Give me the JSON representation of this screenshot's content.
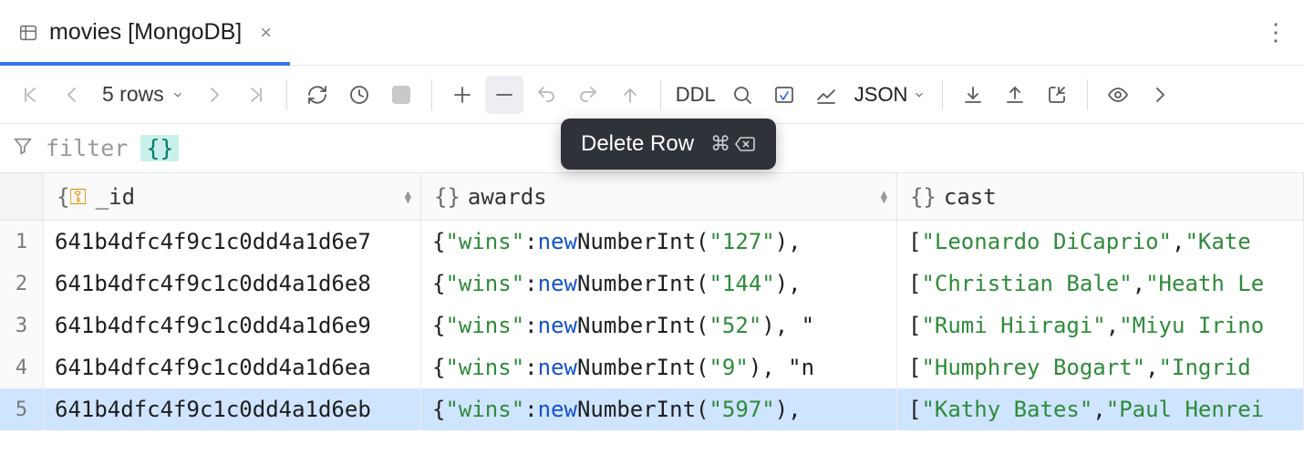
{
  "tab": {
    "title": "movies [MongoDB]"
  },
  "toolbar": {
    "rowcount": "5 rows",
    "ddl": "DDL",
    "format": "JSON"
  },
  "tooltip": {
    "label": "Delete Row",
    "shortcut_symbol": "⌘",
    "shortcut_key": "⌫"
  },
  "filter": {
    "placeholder": "filter",
    "braces": "{}"
  },
  "columns": {
    "id": "_id",
    "awards": "awards",
    "cast": "cast"
  },
  "rows": [
    {
      "num": "1",
      "id": "641b4dfc4f9c1c0dd4a1d6e7",
      "awards": {
        "wins_key": "\"wins\"",
        "kw": "new",
        "fn": "NumberInt(",
        "val": "\"127\"",
        "tail": "),"
      },
      "cast": {
        "open": "[",
        "a": "\"Leonardo DiCaprio\"",
        "sep": ", ",
        "b": "\"Kate"
      }
    },
    {
      "num": "2",
      "id": "641b4dfc4f9c1c0dd4a1d6e8",
      "awards": {
        "wins_key": "\"wins\"",
        "kw": "new",
        "fn": "NumberInt(",
        "val": "\"144\"",
        "tail": "),"
      },
      "cast": {
        "open": "[",
        "a": "\"Christian Bale\"",
        "sep": ", ",
        "b": "\"Heath Le"
      }
    },
    {
      "num": "3",
      "id": "641b4dfc4f9c1c0dd4a1d6e9",
      "awards": {
        "wins_key": "\"wins\"",
        "kw": "new",
        "fn": "NumberInt(",
        "val": "\"52\"",
        "tail": "), \""
      },
      "cast": {
        "open": "[",
        "a": "\"Rumi Hiiragi\"",
        "sep": ", ",
        "b": "\"Miyu Irino"
      }
    },
    {
      "num": "4",
      "id": "641b4dfc4f9c1c0dd4a1d6ea",
      "awards": {
        "wins_key": "\"wins\"",
        "kw": "new",
        "fn": "NumberInt(",
        "val": "\"9\"",
        "tail": "), \"n"
      },
      "cast": {
        "open": "[",
        "a": "\"Humphrey Bogart\"",
        "sep": ", ",
        "b": "\"Ingrid"
      }
    },
    {
      "num": "5",
      "id": "641b4dfc4f9c1c0dd4a1d6eb",
      "awards": {
        "wins_key": "\"wins\"",
        "kw": "new",
        "fn": "NumberInt(",
        "val": "\"597\"",
        "tail": "),"
      },
      "cast": {
        "open": "[",
        "a": "\"Kathy Bates\"",
        "sep": ", ",
        "b": "\"Paul Henrei"
      }
    }
  ]
}
